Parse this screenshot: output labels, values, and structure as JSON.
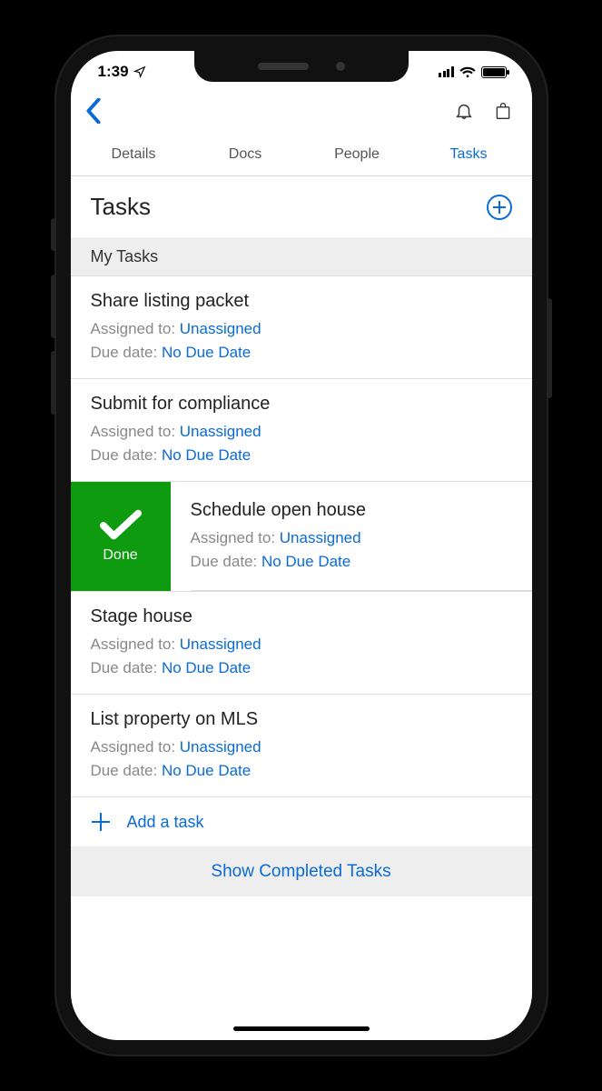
{
  "status": {
    "time": "1:39"
  },
  "tabs": [
    "Details",
    "Docs",
    "People",
    "Tasks"
  ],
  "activeTabIndex": 3,
  "page": {
    "title": "Tasks"
  },
  "section": {
    "title": "My Tasks"
  },
  "labels": {
    "assignedPrefix": "Assigned to: ",
    "duePrefix": "Due date: ",
    "done": "Done",
    "addTask": "Add a task",
    "showCompleted": "Show Completed Tasks"
  },
  "tasks": [
    {
      "title": "Share listing packet",
      "assignee": "Unassigned",
      "due": "No Due Date",
      "swiped": false
    },
    {
      "title": "Submit for compliance",
      "assignee": "Unassigned",
      "due": "No Due Date",
      "swiped": false
    },
    {
      "title": "Schedule open house",
      "assignee": "Unassigned",
      "due": "No Due Date",
      "swiped": true
    },
    {
      "title": "Stage house",
      "assignee": "Unassigned",
      "due": "No Due Date",
      "swiped": false
    },
    {
      "title": "List property on MLS",
      "assignee": "Unassigned",
      "due": "No Due Date",
      "swiped": false
    }
  ]
}
